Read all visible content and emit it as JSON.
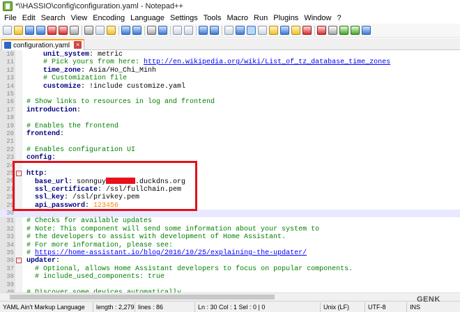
{
  "window": {
    "title": "*\\\\HASSIO\\config\\configuration.yaml - Notepad++"
  },
  "menu": [
    "File",
    "Edit",
    "Search",
    "View",
    "Encoding",
    "Language",
    "Settings",
    "Tools",
    "Macro",
    "Run",
    "Plugins",
    "Window",
    "?"
  ],
  "tab": {
    "label": "configuration.yaml",
    "close_glyph": "×"
  },
  "editor": {
    "lines": [
      {
        "no": "10",
        "fold": "",
        "segments": [
          {
            "t": "    "
          },
          {
            "t": "unit_system",
            "s": "k"
          },
          {
            "t": ": metric"
          }
        ]
      },
      {
        "no": "11",
        "fold": "",
        "segments": [
          {
            "t": "    "
          },
          {
            "t": "# Pick yours from here: ",
            "s": "c"
          },
          {
            "t": "http://en.wikipedia.org/wiki/List_of_tz_database_time_zones",
            "s": "u"
          }
        ]
      },
      {
        "no": "12",
        "fold": "",
        "segments": [
          {
            "t": "    "
          },
          {
            "t": "time_zone",
            "s": "k"
          },
          {
            "t": ": Asia/Ho_Chi_Minh"
          }
        ]
      },
      {
        "no": "13",
        "fold": "",
        "segments": [
          {
            "t": "    "
          },
          {
            "t": "# Customization file",
            "s": "c"
          }
        ]
      },
      {
        "no": "14",
        "fold": "",
        "segments": [
          {
            "t": "    "
          },
          {
            "t": "customize",
            "s": "k"
          },
          {
            "t": ": !include customize.yaml"
          }
        ]
      },
      {
        "no": "15",
        "fold": "",
        "segments": []
      },
      {
        "no": "16",
        "fold": "",
        "segments": [
          {
            "t": "# Show links to resources in log and frontend",
            "s": "c"
          }
        ]
      },
      {
        "no": "17",
        "fold": "",
        "segments": [
          {
            "t": "introduction",
            "s": "k"
          },
          {
            "t": ":"
          }
        ]
      },
      {
        "no": "18",
        "fold": "",
        "segments": []
      },
      {
        "no": "19",
        "fold": "",
        "segments": [
          {
            "t": "# Enables the frontend",
            "s": "c"
          }
        ]
      },
      {
        "no": "20",
        "fold": "",
        "segments": [
          {
            "t": "frontend",
            "s": "k"
          },
          {
            "t": ":"
          }
        ]
      },
      {
        "no": "21",
        "fold": "",
        "segments": []
      },
      {
        "no": "22",
        "fold": "",
        "segments": [
          {
            "t": "# Enables configuration UI",
            "s": "c"
          }
        ]
      },
      {
        "no": "23",
        "fold": "",
        "segments": [
          {
            "t": "config",
            "s": "k"
          },
          {
            "t": ":"
          }
        ]
      },
      {
        "no": "24",
        "fold": "",
        "segments": []
      },
      {
        "no": "25",
        "fold": "minus",
        "segments": [
          {
            "t": "http",
            "s": "k"
          },
          {
            "t": ":"
          }
        ]
      },
      {
        "no": "26",
        "fold": "",
        "segments": [
          {
            "t": "  "
          },
          {
            "t": "base_url",
            "s": "k"
          },
          {
            "t": ": sonnguy"
          },
          {
            "t": "",
            "s": "redact"
          },
          {
            "t": ".duckdns.org"
          }
        ]
      },
      {
        "no": "27",
        "fold": "",
        "segments": [
          {
            "t": "  "
          },
          {
            "t": "ssl_certificate",
            "s": "k"
          },
          {
            "t": ": /ssl/fullchain.pem"
          }
        ]
      },
      {
        "no": "28",
        "fold": "",
        "segments": [
          {
            "t": "  "
          },
          {
            "t": "ssl_key",
            "s": "k"
          },
          {
            "t": ": /ssl/privkey.pem"
          }
        ]
      },
      {
        "no": "29",
        "fold": "",
        "segments": [
          {
            "t": "  "
          },
          {
            "t": "api_password",
            "s": "k"
          },
          {
            "t": ": "
          },
          {
            "t": "123456",
            "s": "n"
          }
        ]
      },
      {
        "no": "30",
        "fold": "",
        "segments": [],
        "caret": true
      },
      {
        "no": "31",
        "fold": "",
        "segments": [
          {
            "t": "# Checks for available updates",
            "s": "c"
          }
        ]
      },
      {
        "no": "32",
        "fold": "",
        "segments": [
          {
            "t": "# Note: This component will send some information about your system to",
            "s": "c"
          }
        ]
      },
      {
        "no": "33",
        "fold": "",
        "segments": [
          {
            "t": "# the developers to assist with development of Home Assistant.",
            "s": "c"
          }
        ]
      },
      {
        "no": "34",
        "fold": "",
        "segments": [
          {
            "t": "# For more information, please see:",
            "s": "c"
          }
        ]
      },
      {
        "no": "35",
        "fold": "",
        "segments": [
          {
            "t": "# ",
            "s": "c"
          },
          {
            "t": "https://home-assistant.io/blog/2016/10/25/explaining-the-updater/",
            "s": "u"
          }
        ]
      },
      {
        "no": "36",
        "fold": "minus",
        "segments": [
          {
            "t": "updater",
            "s": "k"
          },
          {
            "t": ":"
          }
        ]
      },
      {
        "no": "37",
        "fold": "",
        "segments": [
          {
            "t": "  "
          },
          {
            "t": "# Optional, allows Home Assistant developers to focus on popular components.",
            "s": "c"
          }
        ]
      },
      {
        "no": "38",
        "fold": "",
        "segments": [
          {
            "t": "  "
          },
          {
            "t": "# include_used_components: true",
            "s": "c"
          }
        ]
      },
      {
        "no": "39",
        "fold": "",
        "segments": []
      },
      {
        "no": "40",
        "fold": "",
        "segments": [
          {
            "t": "# Discover some devices automatically",
            "s": "c"
          }
        ]
      }
    ]
  },
  "status": {
    "language": "YAML Ain't Markup Language",
    "length": "length : 2,279",
    "lines": "lines : 86",
    "position": "Ln : 30   Col : 1   Sel : 0 | 0",
    "eol": "Unix (LF)",
    "encoding": "UTF-8",
    "mode": "INS"
  },
  "watermark": "GENK",
  "colors": {
    "highlight_box": "#e3101b",
    "tab_accent": "#f6a21a",
    "keyword": "#000080",
    "comment": "#008000",
    "link": "#0000ff",
    "number": "#ff8000"
  }
}
